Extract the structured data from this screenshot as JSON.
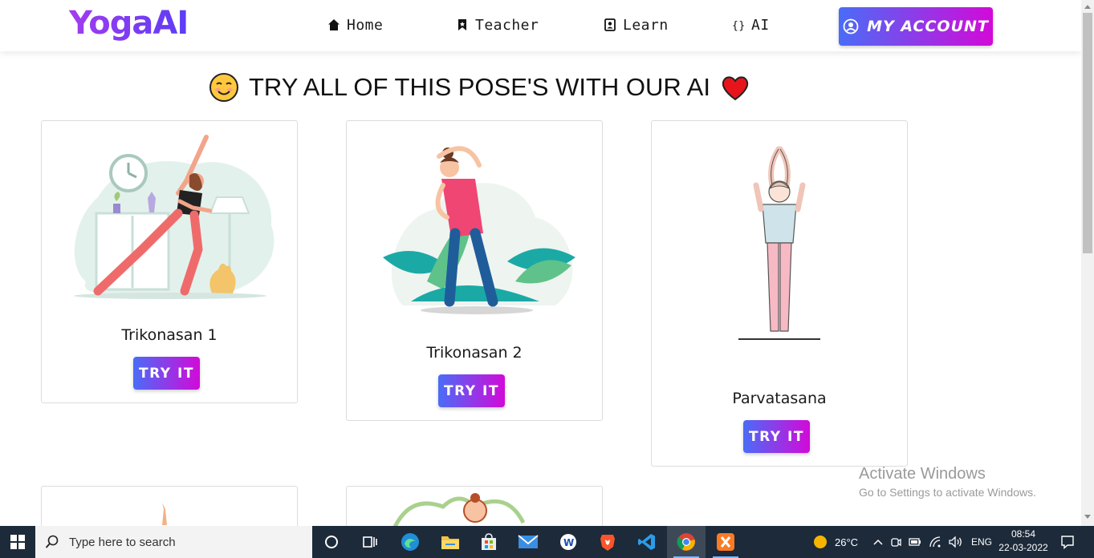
{
  "brand": {
    "name": "YogaAI"
  },
  "nav": {
    "items": [
      {
        "label": "Home",
        "icon": "home-icon"
      },
      {
        "label": "Teacher",
        "icon": "bookmark-icon"
      },
      {
        "label": "Learn",
        "icon": "contact-card-icon"
      },
      {
        "label": "AI",
        "icon": "braces-icon"
      }
    ],
    "account_label": "MY ACCOUNT"
  },
  "headline": {
    "text": "TRY ALL OF THIS POSE'S WITH OUR AI"
  },
  "cards": [
    {
      "title": "Trikonasan 1",
      "button": "TRY IT"
    },
    {
      "title": "Trikonasan 2",
      "button": "TRY IT"
    },
    {
      "title": "Parvatasana",
      "button": "TRY IT"
    }
  ],
  "watermark": {
    "title": "Activate Windows",
    "subtitle": "Go to Settings to activate Windows."
  },
  "taskbar": {
    "search_placeholder": "Type here to search",
    "weather": "26°C",
    "language": "ENG",
    "time": "08:54",
    "date": "22-03-2022",
    "apps": [
      "cortana-icon",
      "task-view-icon",
      "edge-icon",
      "file-explorer-icon",
      "store-icon",
      "mail-icon",
      "app-w-icon",
      "brave-icon",
      "vscode-icon",
      "chrome-icon",
      "xampp-icon"
    ]
  },
  "colors": {
    "button_gradient_start": "#4a6cf7",
    "button_gradient_end": "#d20ad8",
    "logo_gradient_start": "#a33bf0",
    "logo_gradient_end": "#5b3df5"
  }
}
